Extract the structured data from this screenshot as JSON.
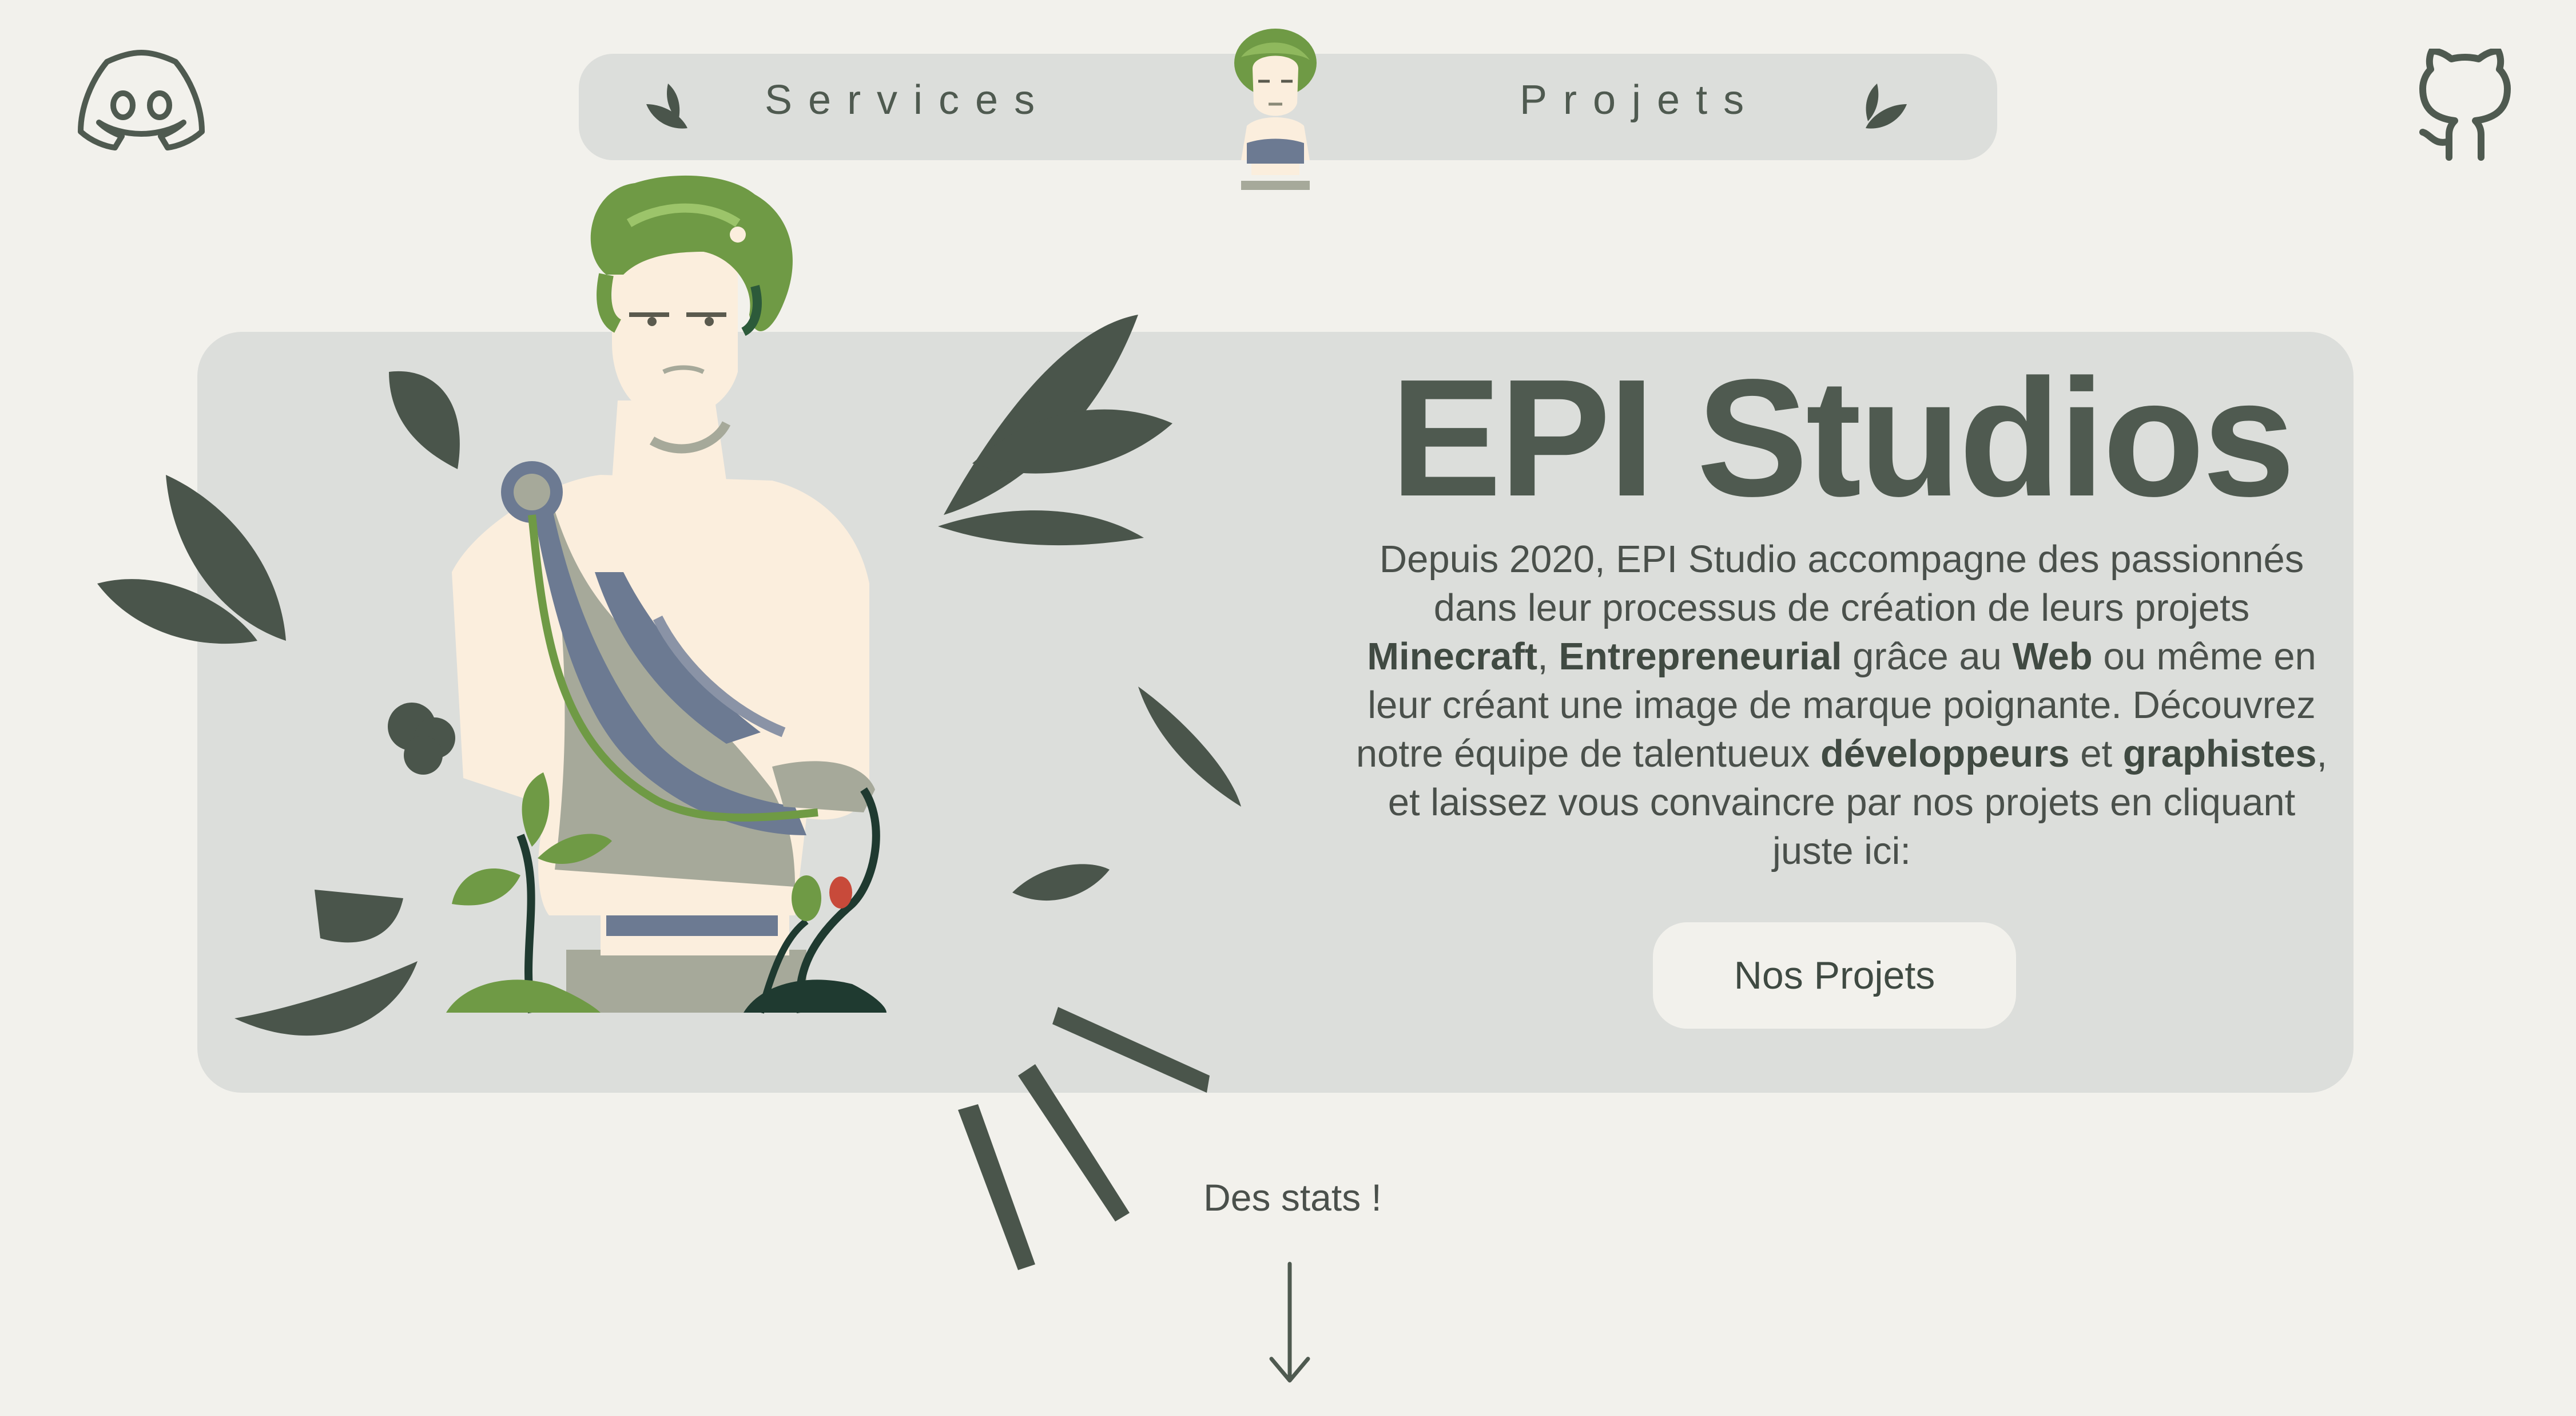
{
  "nav": {
    "services_label": "Services",
    "projets_label": "Projets"
  },
  "icons": {
    "discord": "discord-icon",
    "github": "github-icon",
    "leaf": "leaf-icon",
    "arrow": "arrow-down-icon"
  },
  "hero": {
    "title": "EPI Studios",
    "description": {
      "t1": "Depuis 2020, EPI Studio accompagne des passionnés dans leur processus de création de leurs projets ",
      "b1": "Minecraft",
      "t2": ", ",
      "b2": "Entrepreneurial",
      "t3": " grâce au ",
      "b3": "Web",
      "t4": " ou même en leur créant une image de marque poignante. Découvrez notre équipe de talentueux ",
      "b4": "développeurs",
      "t5": " et ",
      "b5": "graphistes",
      "t6": ", et laissez vous convaincre par nos projets en cliquant juste ici:"
    },
    "button_label": "Nos Projets"
  },
  "stats": {
    "label": "Des stats !"
  },
  "colors": {
    "background": "#f2f1ec",
    "card": "#dcdedb",
    "text": "#4f5a50",
    "leaf": "#4a554b",
    "statue_green": "#6f9a45",
    "statue_skin": "#fbeedd",
    "drape_blue": "#6c7a92"
  }
}
